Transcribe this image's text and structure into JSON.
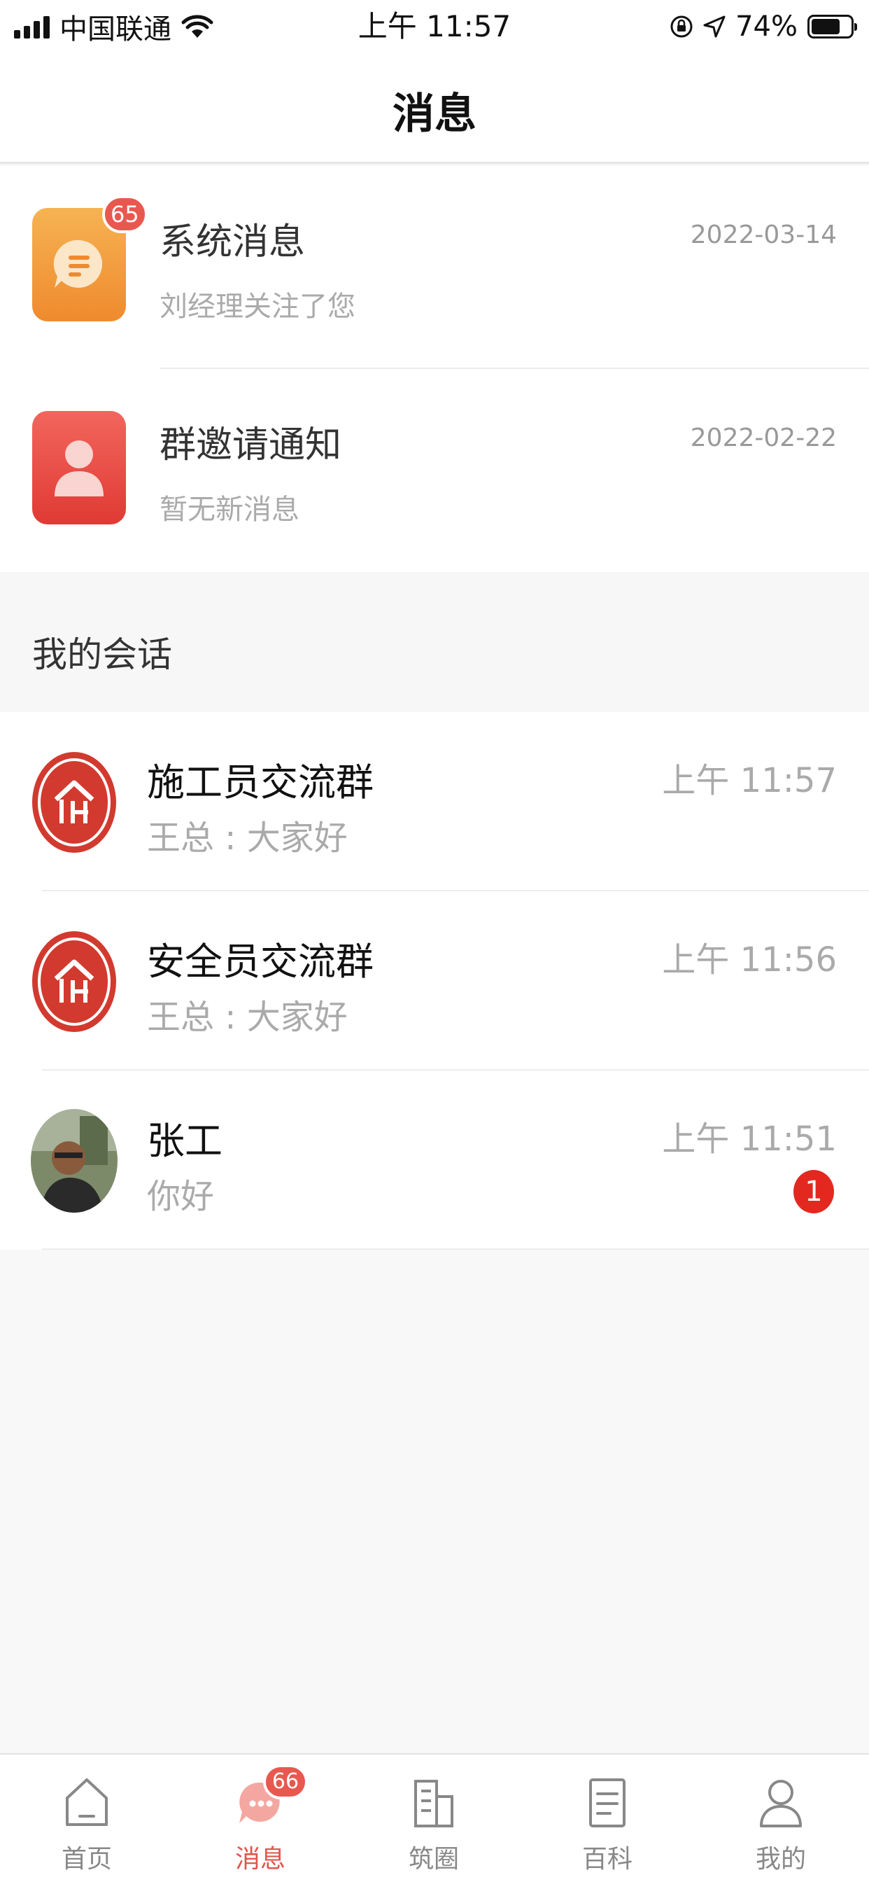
{
  "status_bar": {
    "carrier": "中国联通",
    "time": "上午 11:57",
    "battery": "74%",
    "battery_level": 0.74
  },
  "header": {
    "title": "消息"
  },
  "notifications": [
    {
      "title": "系统消息",
      "subtitle": "刘经理关注了您",
      "date": "2022-03-14",
      "badge": "65",
      "icon": "chat-bubble-icon",
      "color": "#ef8a2e"
    },
    {
      "title": "群邀请通知",
      "subtitle": "暂无新消息",
      "date": "2022-02-22",
      "icon": "person-icon",
      "color": "#e03a34"
    }
  ],
  "conversations_section": {
    "title": "我的会话"
  },
  "conversations": [
    {
      "name": "施工员交流群",
      "message": "王总 : 大家好",
      "time": "上午 11:57",
      "avatar": "group-logo-icon"
    },
    {
      "name": "安全员交流群",
      "message": "王总 : 大家好",
      "time": "上午 11:56",
      "avatar": "group-logo-icon"
    },
    {
      "name": "张工",
      "message": "你好",
      "time": "上午 11:51",
      "avatar": "user-photo",
      "unread": "1"
    }
  ],
  "tab_bar": {
    "items": [
      {
        "label": "首页",
        "icon": "home-icon"
      },
      {
        "label": "消息",
        "icon": "message-icon",
        "badge": "66",
        "active": true
      },
      {
        "label": "筑圈",
        "icon": "buildings-icon"
      },
      {
        "label": "百科",
        "icon": "book-icon"
      },
      {
        "label": "我的",
        "icon": "profile-icon"
      }
    ]
  },
  "colors": {
    "accent": "#e0554b",
    "badge": "#e9584f",
    "unread": "#e3291f"
  }
}
